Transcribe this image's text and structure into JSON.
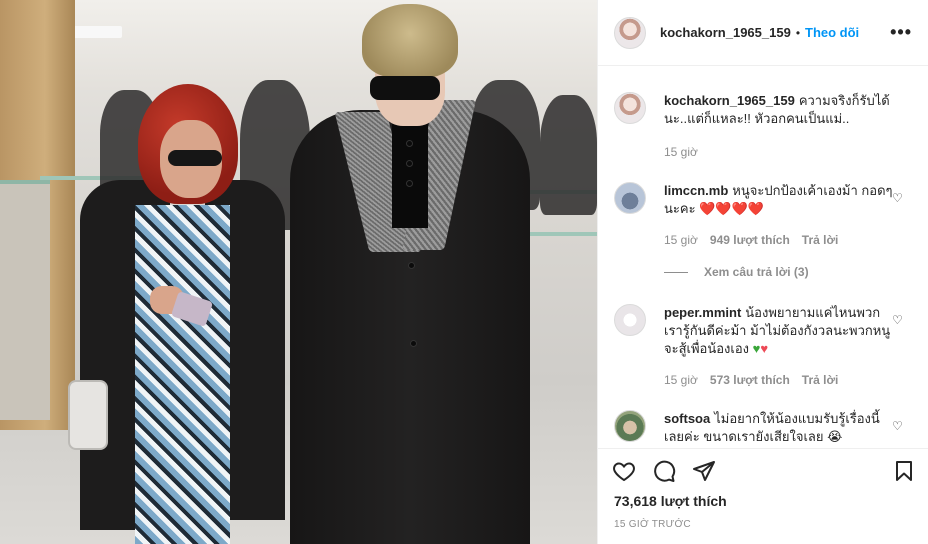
{
  "post": {
    "username": "kochakorn_1965_159",
    "follow_label": "Theo dõi",
    "more_icon": "more-horizontal-icon"
  },
  "caption": {
    "username": "kochakorn_1965_159",
    "text": "ความจริงก็รับได้นะ..แต่ก็แหละ!! หัวอกคนเป็นแม่..",
    "time": "15 giờ"
  },
  "comments": [
    {
      "username": "limccn.mb",
      "text": "หนูจะปกป้องเค้าเองม้า กอดๆนะคะ",
      "emoji": "❤️❤️❤️❤️",
      "time": "15 giờ",
      "likes": "949 lượt thích",
      "reply": "Trả lời",
      "view_replies": "Xem câu trả lời (3)"
    },
    {
      "username": "peper.mmint",
      "text": "น้องพยายามแค่ไหนพวกเรารู้กันดีค่ะม้า ม้าไม่ต้องกังวลนะพวกหนูจะสู้เพื่อน้องเอง",
      "emoji_green": "♥",
      "emoji_red": "♥",
      "time": "15 giờ",
      "likes": "573 lượt thích",
      "reply": "Trả lời"
    },
    {
      "username": "softsoa",
      "text": "ไม่อยากให้น้องแบมรับรู้เรื่องนี้เลยค่ะ ขนาดเรายังเสียใจเลย",
      "emoji": "😭"
    }
  ],
  "footer": {
    "likes": "73,618 lượt thích",
    "time_ago": "15 GIỜ TRƯỚC"
  },
  "colors": {
    "accent": "#0095f6",
    "heart": "#ed4956",
    "muted": "#8e8e8e",
    "text": "#262626"
  }
}
